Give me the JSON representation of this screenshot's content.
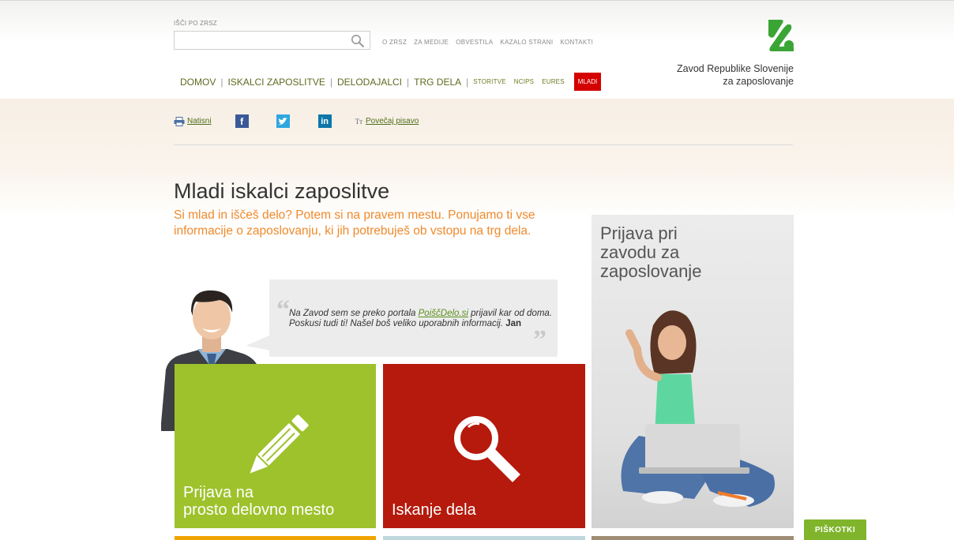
{
  "search": {
    "label": "IŠČI PO ZRSZ",
    "value": "",
    "placeholder": ""
  },
  "top_links": [
    "O ZRSZ",
    "ZA MEDIJE",
    "OBVESTILA",
    "KAZALO STRANI",
    "KONTAKTI"
  ],
  "main_nav": {
    "domov": "DOMOV",
    "iskalci": "ISKALCI ZAPOSLITVE",
    "delodajalci": "DELODAJALCI",
    "trg": "TRG DELA",
    "storitve": "STORITVE",
    "ncips": "NCIPS",
    "eures": "EURES",
    "mladi": "MLADI"
  },
  "org": {
    "line1": "Zavod Republike Slovenije",
    "line2": "za zaposlovanje"
  },
  "tools": {
    "print": "Natisni",
    "font": "Povečaj pisavo",
    "font_icon": "Tт"
  },
  "page": {
    "title": "Mladi iskalci zaposlitve",
    "lead": "Si mlad in iščeš delo? Potem si na pravem mestu. Ponujamo ti vse informacije o zaposlovanju, ki jih potrebuješ ob vstopu na trg dela."
  },
  "quote": {
    "before": "Na Zavod sem se preko portala ",
    "link": "PoiščDelo.si",
    "after": " prijavil kar od doma. Poskusi tudi ti! Našel boš veliko uporabnih informacij. ",
    "author": "Jan"
  },
  "tiles": {
    "prijava_delo_1": "Prijava na",
    "prijava_delo_2": "prosto delovno mesto",
    "iskanje": "Iskanje dela",
    "prijava_zavod_1": "Prijava pri",
    "prijava_zavod_2": "zavodu za",
    "prijava_zavod_3": "zaposlovanje"
  },
  "cookie_button": "PIŠKOTKI",
  "colors": {
    "green": "#9dc22b",
    "red": "#b51a0c",
    "accent_orange": "#ef8a2c",
    "mladi_red": "#d50000"
  },
  "icons": [
    "search-icon",
    "printer-icon",
    "facebook-icon",
    "twitter-icon",
    "linkedin-icon",
    "pencil-icon",
    "magnifier-icon"
  ]
}
